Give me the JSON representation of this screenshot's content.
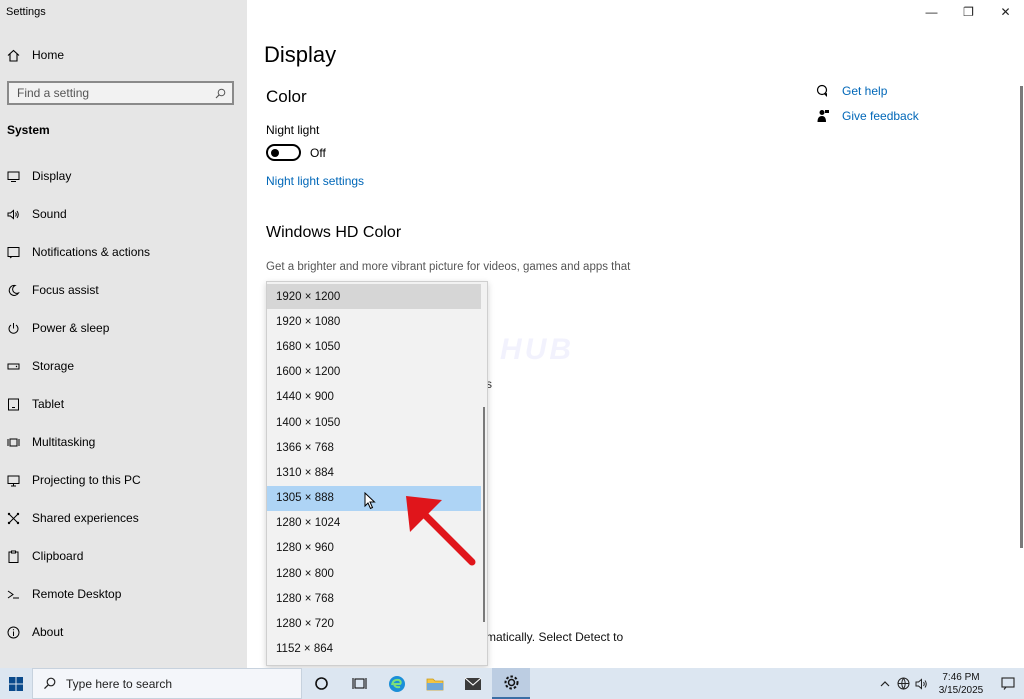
{
  "window": {
    "title": "Settings",
    "controls": {
      "minimize": "—",
      "restore": "❐",
      "close": "✕"
    }
  },
  "sidebar": {
    "home_label": "Home",
    "search_placeholder": "Find a setting",
    "section_label": "System",
    "items": [
      {
        "label": "Display",
        "icon": "monitor-icon"
      },
      {
        "label": "Sound",
        "icon": "speaker-icon"
      },
      {
        "label": "Notifications & actions",
        "icon": "notification-icon"
      },
      {
        "label": "Focus assist",
        "icon": "moon-icon"
      },
      {
        "label": "Power & sleep",
        "icon": "power-icon"
      },
      {
        "label": "Storage",
        "icon": "storage-icon"
      },
      {
        "label": "Tablet",
        "icon": "tablet-icon"
      },
      {
        "label": "Multitasking",
        "icon": "multitasking-icon"
      },
      {
        "label": "Projecting to this PC",
        "icon": "projector-icon"
      },
      {
        "label": "Shared experiences",
        "icon": "shared-icon"
      },
      {
        "label": "Clipboard",
        "icon": "clipboard-icon"
      },
      {
        "label": "Remote Desktop",
        "icon": "remote-desktop-icon"
      },
      {
        "label": "About",
        "icon": "info-icon"
      }
    ]
  },
  "main": {
    "title": "Display",
    "color_heading": "Color",
    "night_light_label": "Night light",
    "night_light_state": "Off",
    "night_light_link": "Night light settings",
    "hdr_heading": "Windows HD Color",
    "hdr_desc": "Get a brighter and more vibrant picture for videos, games and apps that",
    "fragment_s": "s",
    "detect_text": "matically. Select Detect to",
    "watermark": "IT Pros HUB"
  },
  "help": {
    "get_help": "Get help",
    "give_feedback": "Give feedback"
  },
  "resolution_dropdown": {
    "options": [
      "1920 × 1200",
      "1920 × 1080",
      "1680 × 1050",
      "1600 × 1200",
      "1440 × 900",
      "1400 × 1050",
      "1366 × 768",
      "1310 × 884",
      "1305 × 888",
      "1280 × 1024",
      "1280 × 960",
      "1280 × 800",
      "1280 × 768",
      "1280 × 720",
      "1152 × 864"
    ],
    "highlighted": "1305 × 888"
  },
  "taskbar": {
    "search_placeholder": "Type here to search",
    "time": "7:46 PM",
    "date": "3/15/2025"
  },
  "colors": {
    "sidebar_bg": "#e6e6e6",
    "link": "#0067b8",
    "selected_option": "#aed4f5",
    "arrow": "#e0151b"
  }
}
